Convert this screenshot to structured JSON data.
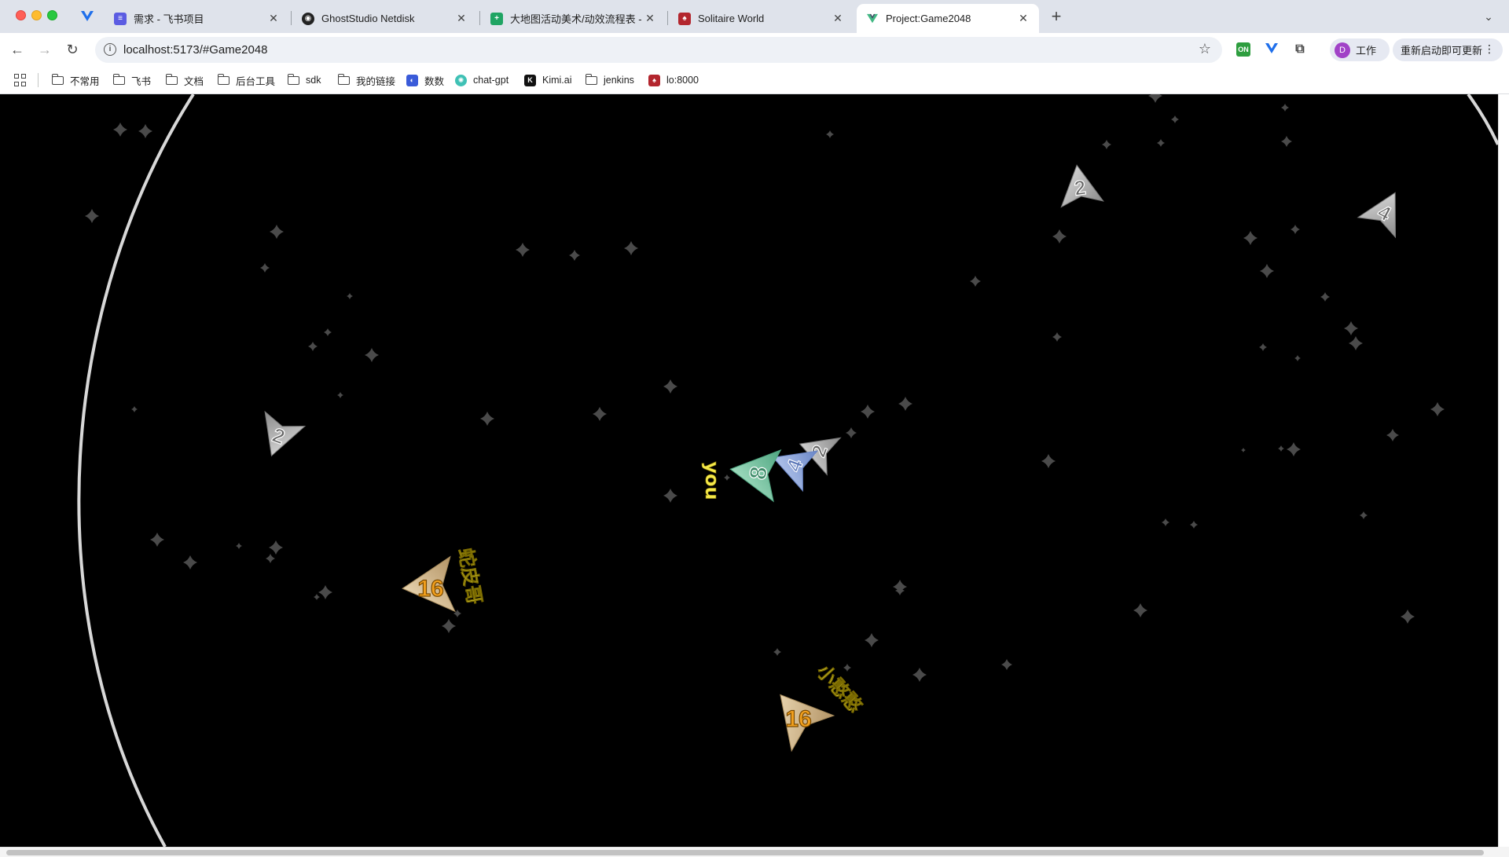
{
  "browser": {
    "tabs": [
      {
        "title": "需求 - 飞书项目",
        "favicon_color": "#5b5ce2",
        "active": false
      },
      {
        "title": "GhostStudio Netdisk",
        "favicon_color": "#222222",
        "active": false
      },
      {
        "title": "大地图活动美术/动效流程表 - G",
        "favicon_color": "#1fa463",
        "active": false
      },
      {
        "title": "Solitaire World",
        "favicon_color": "#b3262e",
        "active": false
      },
      {
        "title": "Project:Game2048",
        "favicon_color": "#41b883",
        "active": true
      }
    ],
    "url": "localhost:5173/#Game2048",
    "profile_initial": "D",
    "profile_name": "工作",
    "update_label": "重新启动即可更新",
    "bookmarks": [
      {
        "label": "不常用",
        "icon": "folder-icon"
      },
      {
        "label": "飞书",
        "icon": "folder-icon"
      },
      {
        "label": "文档",
        "icon": "folder-icon"
      },
      {
        "label": "后台工具",
        "icon": "folder-icon"
      },
      {
        "label": "sdk",
        "icon": "folder-icon"
      },
      {
        "label": "我的链接",
        "icon": "folder-icon"
      },
      {
        "label": "数数",
        "icon": "site-icon"
      },
      {
        "label": "chat-gpt",
        "icon": "site-icon"
      },
      {
        "label": "Kimi.ai",
        "icon": "site-icon"
      },
      {
        "label": "jenkins",
        "icon": "folder-icon"
      },
      {
        "label": "lo:8000",
        "icon": "site-icon"
      }
    ]
  },
  "game": {
    "players": [
      {
        "name": "you",
        "tiles": [
          "8",
          "4",
          "2"
        ],
        "is_self": true
      },
      {
        "name": "蛇皮哥",
        "tiles": [
          "16"
        ],
        "is_self": false
      },
      {
        "name": "小憨憨",
        "tiles": [
          "16"
        ],
        "is_self": false
      }
    ],
    "loose_pieces": [
      "2",
      "2",
      "4"
    ],
    "colors": {
      "background": "#000000",
      "boundary": "#d8d8d8",
      "label": "#f5e94a",
      "tile_2": "#c9c9c9",
      "tile_4": "#9eb6e6",
      "tile_8": "#8fd0b0",
      "tile_16": "#e8cfa2",
      "number_16": "#f2a01e"
    }
  }
}
